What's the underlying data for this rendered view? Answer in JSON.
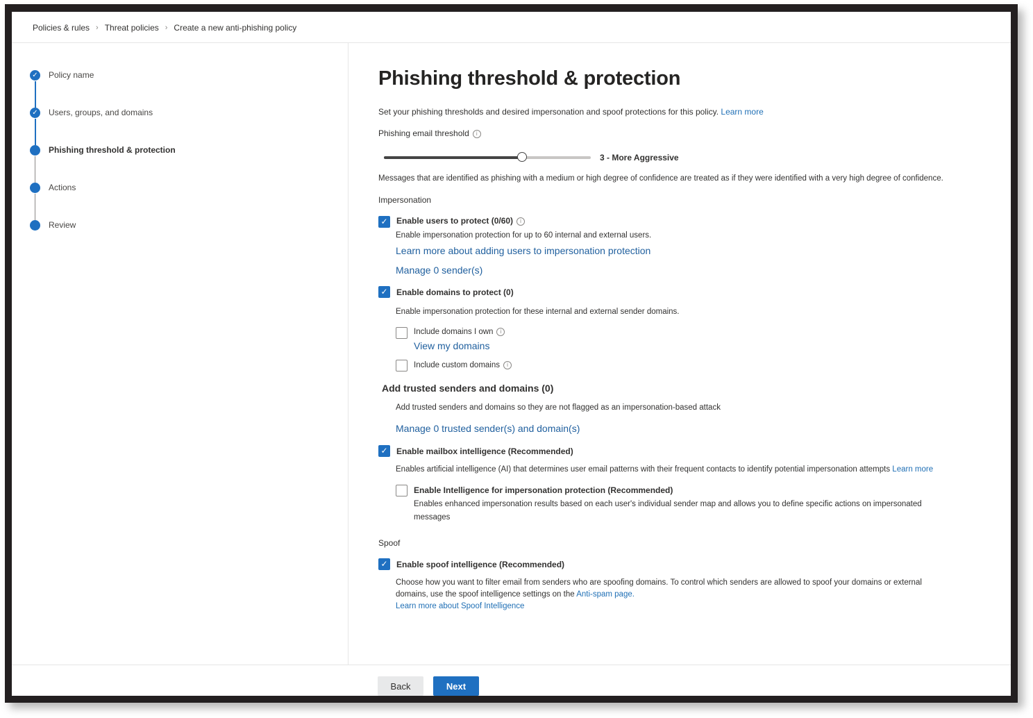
{
  "breadcrumb": [
    {
      "label": "Policies & rules"
    },
    {
      "label": "Threat policies"
    },
    {
      "label": "Create a new anti-phishing policy"
    }
  ],
  "breadcrumb_separator": ">",
  "steps": [
    {
      "label": "Policy name",
      "state": "completed"
    },
    {
      "label": "Users, groups, and domains",
      "state": "completed"
    },
    {
      "label": "Phishing threshold & protection",
      "state": "current"
    },
    {
      "label": "Actions",
      "state": "upcoming"
    },
    {
      "label": "Review",
      "state": "upcoming"
    }
  ],
  "main": {
    "title": "Phishing threshold & protection",
    "intro": "Set your phishing thresholds and desired impersonation and spoof protections for this policy.",
    "intro_link": "Learn more",
    "threshold_label": "Phishing email threshold",
    "threshold": {
      "value": 3,
      "min": 1,
      "max": 4,
      "label": "3 - More Aggressive"
    },
    "threshold_desc": "Messages that are identified as phishing with a medium or high degree of confidence are treated as if they were identified with a very high degree of confidence.",
    "impersonation_heading": "Impersonation",
    "users": {
      "label": "Enable users to protect (0/60)",
      "checked": true,
      "desc": "Enable impersonation protection for up to 60 internal and external users.",
      "learn_link": "Learn more about adding users to impersonation protection",
      "manage_link": "Manage 0 sender(s)"
    },
    "domains": {
      "label": "Enable domains to protect (0)",
      "checked": true,
      "desc": "Enable impersonation protection for these internal and external sender domains.",
      "own_label": "Include domains I own",
      "own_checked": false,
      "view_link": "View my domains",
      "custom_label": "Include custom domains",
      "custom_checked": false
    },
    "trusted": {
      "heading": "Add trusted senders and domains (0)",
      "desc": "Add trusted senders and domains so they are not flagged as an impersonation-based attack",
      "manage_link": "Manage 0 trusted sender(s) and domain(s)"
    },
    "mailbox": {
      "label": "Enable mailbox intelligence (Recommended)",
      "checked": true,
      "desc": "Enables artificial intelligence (AI) that determines user email patterns with their frequent contacts to identify potential impersonation attempts",
      "link": "Learn more"
    },
    "intel_imp": {
      "label": "Enable Intelligence for impersonation protection (Recommended)",
      "checked": false,
      "desc1": "Enables enhanced impersonation results based on each user's individual sender map and allows you to define specific actions on impersonated",
      "desc2": "messages"
    },
    "spoof_heading": "Spoof",
    "spoof": {
      "label": "Enable spoof intelligence (Recommended)",
      "checked": true,
      "desc1": "Choose how you want to filter email from senders who are spoofing domains. To control which senders are allowed to spoof your domains or external",
      "desc2": "domains, use the spoof intelligence settings on the",
      "desc2_link": "Anti-spam page.",
      "learn_link": "Learn more about Spoof Intelligence"
    }
  },
  "footer": {
    "back_label": "Back",
    "next_label": "Next"
  },
  "colors": {
    "accent": "#1f70c1",
    "link": "#1f6fb5",
    "frame": "#231f20"
  }
}
